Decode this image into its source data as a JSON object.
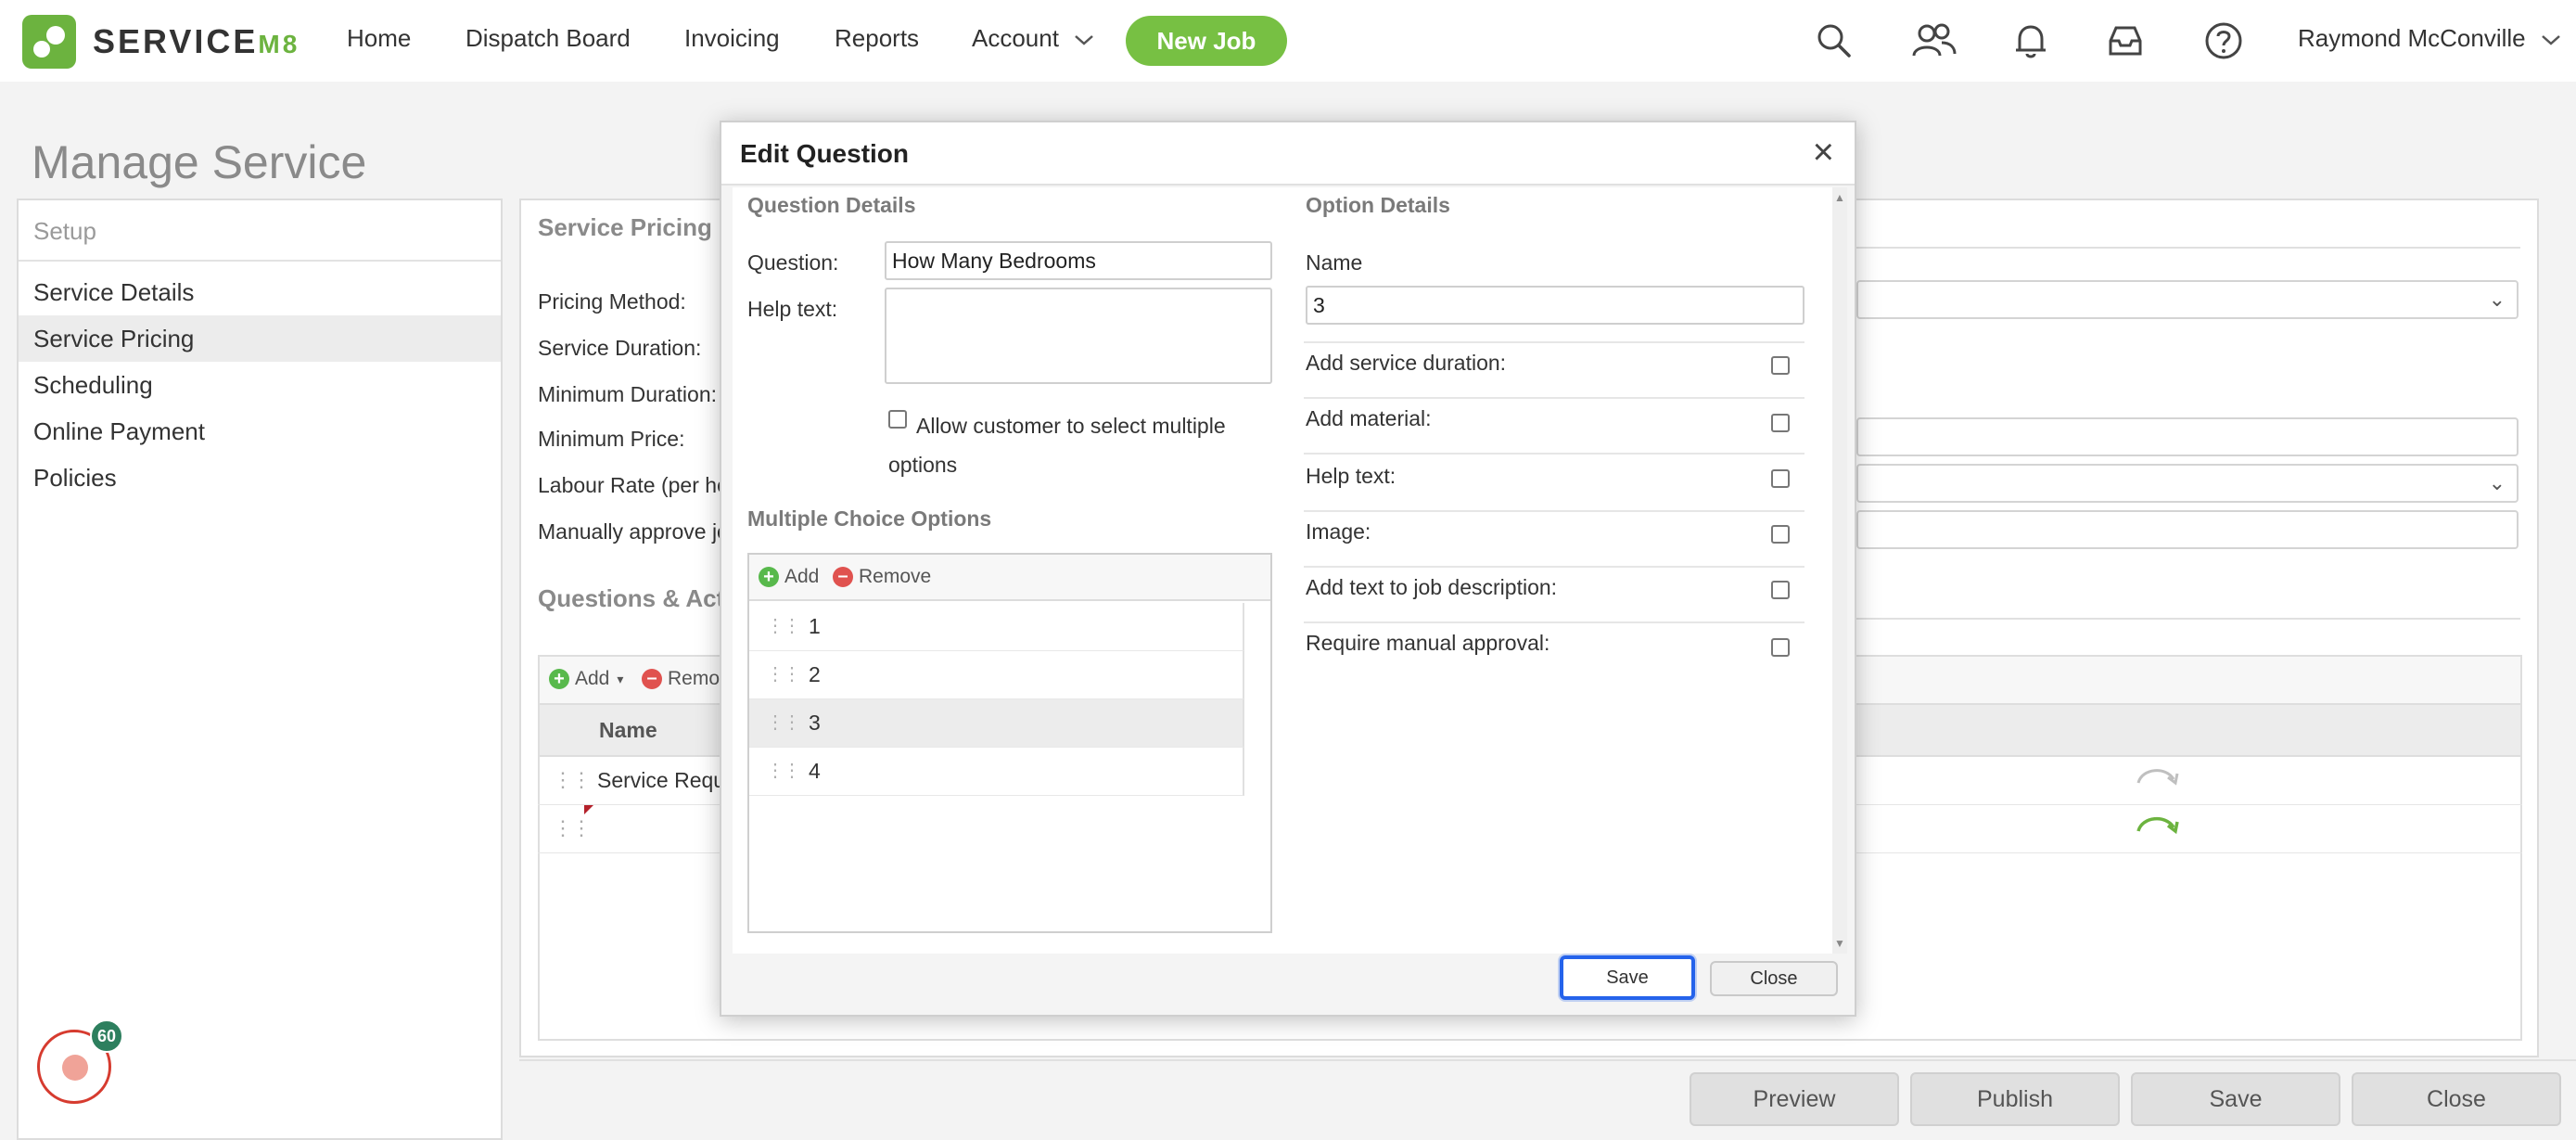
{
  "nav": {
    "brand_main": "SERVICE",
    "brand_suffix": "M8",
    "items": [
      "Home",
      "Dispatch Board",
      "Invoicing",
      "Reports",
      "Account"
    ],
    "new_job": "New Job",
    "user": "Raymond McConville"
  },
  "page": {
    "title": "Manage Service"
  },
  "setup": {
    "heading": "Setup",
    "items": [
      "Service Details",
      "Service Pricing",
      "Scheduling",
      "Online Payment",
      "Policies"
    ],
    "active_index": 1
  },
  "pricing": {
    "title": "Service Pricing",
    "labels": [
      "Pricing Method:",
      "Service Duration:",
      "Minimum Duration:",
      "Minimum Price:",
      "Labour Rate (per hou",
      "Manually approve jo"
    ]
  },
  "questions": {
    "title": "Questions & Acti",
    "add": "Add",
    "remove": "Remo",
    "col_name": "Name",
    "row1": "Service Requi"
  },
  "footer": {
    "preview": "Preview",
    "publish": "Publish",
    "save": "Save",
    "close": "Close"
  },
  "badge": {
    "count": "60"
  },
  "dialog": {
    "title": "Edit Question",
    "question_details": "Question Details",
    "question_label": "Question:",
    "question_value": "How Many Bedrooms",
    "help_label": "Help text:",
    "allow_multiple": "Allow customer to select multiple options",
    "mc_title": "Multiple Choice Options",
    "mc_add": "Add",
    "mc_remove": "Remove",
    "options": [
      "1",
      "2",
      "3",
      "4"
    ],
    "selected_option": 2,
    "option_details": "Option Details",
    "name_label": "Name",
    "name_value": "3",
    "checks": [
      "Add service duration:",
      "Add material:",
      "Help text:",
      "Image:",
      "Add text to job description:",
      "Require manual approval:"
    ],
    "save": "Save",
    "close": "Close"
  },
  "colors": {
    "brand_green": "#6cb33f",
    "focus_blue": "#2563eb",
    "badge_teal": "#2d7f5e"
  }
}
